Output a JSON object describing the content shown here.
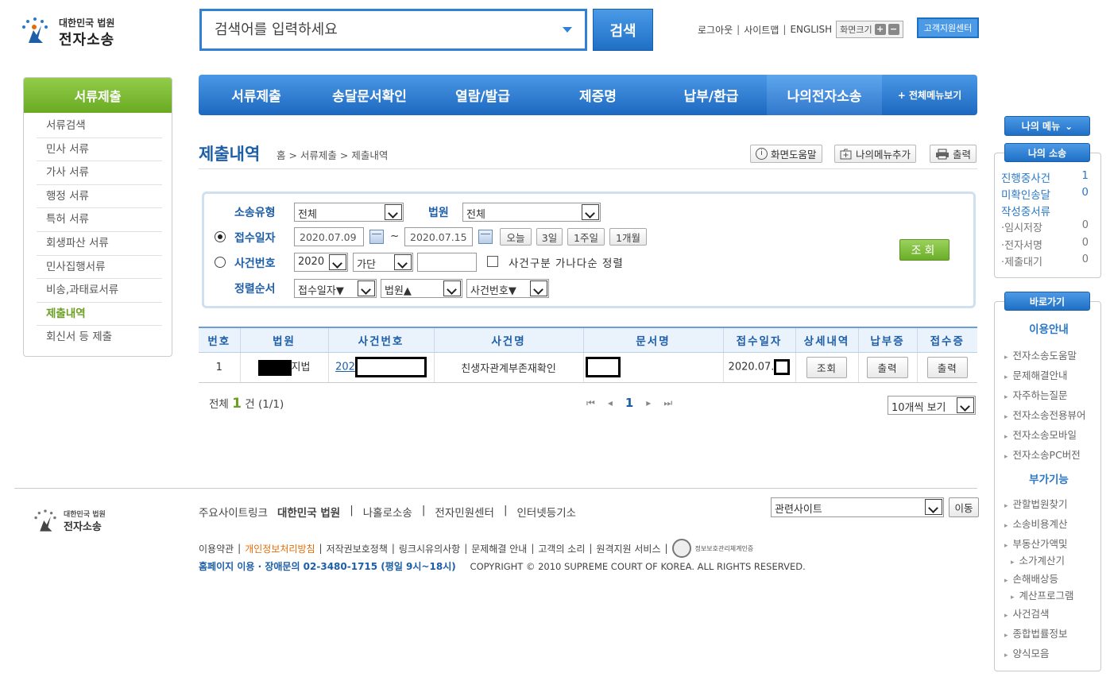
{
  "header": {
    "logo_line1": "대한민국 법원",
    "logo_line2": "전자소송",
    "search_placeholder": "검색어를 입력하세요",
    "search_button": "검색",
    "util": {
      "logout": "로그아웃",
      "sitemap": "사이트맵",
      "english": "ENGLISH",
      "font_size": "화면크기",
      "customer_center": "고객지원센터"
    }
  },
  "gnb": {
    "items": [
      "서류제출",
      "송달문서확인",
      "열람/발급",
      "제증명",
      "납부/환급",
      "나의전자소송"
    ],
    "active_index": 5,
    "all_menu": "+ 전체메뉴보기"
  },
  "lnb": {
    "title": "서류제출",
    "items": [
      "서류검색",
      "민사 서류",
      "가사 서류",
      "행정 서류",
      "특허 서류",
      "회생파산 서류",
      "민사집행서류",
      "비송,과태료서류",
      "제출내역",
      "회신서 등 제출"
    ],
    "active_index": 8
  },
  "page": {
    "title": "제출내역",
    "breadcrumb": "홈 > 서류제출 > 제출내역",
    "buttons": {
      "help": "화면도움말",
      "add_menu": "나의메뉴추가",
      "print": "출력"
    }
  },
  "form": {
    "type_label": "소송유형",
    "type_value": "전체",
    "court_label": "법원",
    "court_value": "전체",
    "date_label": "접수일자",
    "date_from": "2020.07.09",
    "date_to": "2020.07.15",
    "date_sep": "~",
    "quick": [
      "오늘",
      "3일",
      "1주일",
      "1개월"
    ],
    "case_label": "사건번호",
    "case_year": "2020",
    "case_kind": "가단",
    "case_number": "",
    "sort_check_label": "사건구분 가나다순 정렬",
    "order_label": "정렬순서",
    "order1": "접수일자▼",
    "order2": "법원▲",
    "order3": "사건번호▼",
    "search_button": "조회"
  },
  "table": {
    "headers": [
      "번호",
      "법원",
      "사건번호",
      "사건명",
      "문서명",
      "접수일자",
      "상세내역",
      "납부증",
      "접수증"
    ],
    "rows": [
      {
        "no": "1",
        "court_suffix": "지법",
        "case_no_prefix": "202",
        "case_name": "친생자관계부존재확인",
        "doc_name": "",
        "date_prefix": "2020.07.",
        "detail": "조회",
        "payment": "출력",
        "receipt": "출력"
      }
    ]
  },
  "summary": {
    "total_prefix": "전체",
    "total_count": "1",
    "total_suffix": "건 (1/1)"
  },
  "pager": {
    "first": "⏮",
    "prev": "◂",
    "current": "1",
    "next": "▸",
    "last": "⏭",
    "per_page": "10개씩 보기"
  },
  "right": {
    "my_menu": "나의 메뉴",
    "my_lit_title": "나의 소송",
    "my_lit": [
      {
        "label": "진행중사건",
        "count": "1"
      },
      {
        "label": "미확인송달",
        "count": "0"
      },
      {
        "label": "작성중서류",
        "count": ""
      }
    ],
    "drafts": [
      {
        "label": "·임시저장",
        "count": "0"
      },
      {
        "label": "·전자서명",
        "count": "0"
      },
      {
        "label": "·제출대기",
        "count": "0"
      }
    ],
    "shortcut_title": "바로가기",
    "guide_title": "이용안내",
    "guide": [
      "전자소송도움말",
      "문제해결안내",
      "자주하는질문",
      "전자소송전용뷰어",
      "전자소송모바일",
      "전자소송PC버전"
    ],
    "extra_title": "부가기능",
    "extra": [
      "관할법원찾기",
      "소송비용계산",
      "부동산가액및",
      "소가계산기",
      "손해배상등",
      "계산프로그램",
      "사건검색",
      "종합법률정보",
      "양식모음"
    ]
  },
  "footer": {
    "logo_line1": "대한민국 법원",
    "logo_line2": "전자소송",
    "major": "주요사이트링크",
    "links": [
      "대한민국 법원",
      "나홀로소송",
      "전자민원센터",
      "인터넷등기소"
    ],
    "related": "관련사이트",
    "move": "이동",
    "policy": [
      "이용약관",
      "개인정보처리방침",
      "저작권보호정책",
      "링크시유의사항",
      "문제해결 안내",
      "고객의 소리",
      "원격지원 서비스"
    ],
    "privacy_mark": "정보보호관리체계인증",
    "tel": "홈페이지 이용 · 장애문의 02-3480-1715 (평일 9시~18시)",
    "copyright": "COPYRIGHT © 2010 SUPREME COURT OF KOREA. ALL RIGHTS RESERVED."
  },
  "colors": {
    "brand_blue": "#1f6fc6",
    "green": "#6aad28",
    "dark_blue_text": "#1d5ea8"
  }
}
